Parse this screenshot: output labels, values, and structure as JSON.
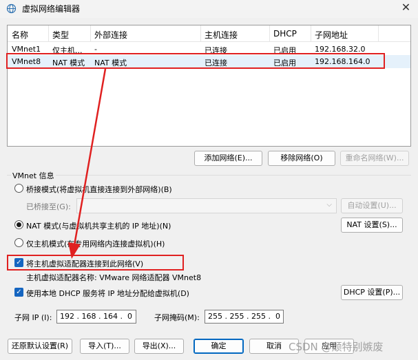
{
  "window": {
    "title": "虚拟网络编辑器",
    "close_glyph": "✕"
  },
  "table": {
    "headers": [
      "名称",
      "类型",
      "外部连接",
      "主机连接",
      "DHCP",
      "子网地址"
    ],
    "rows": [
      [
        "VMnet1",
        "仅主机...",
        "-",
        "已连接",
        "已启用",
        "192.168.32.0"
      ],
      [
        "VMnet8",
        "NAT 模式",
        "NAT 模式",
        "已连接",
        "已启用",
        "192.168.164.0"
      ]
    ],
    "selected_row": 1
  },
  "list_buttons": {
    "add": "添加网络(E)...",
    "remove": "移除网络(O)",
    "rename": "重命名网络(W)..."
  },
  "vmnet_info": {
    "group_title": "VMnet 信息",
    "bridge_label": "桥接模式(将虚拟机直接连接到外部网络)(B)",
    "bridged_to_label": "已桥接至(G):",
    "bridged_to_value": "",
    "auto_settings": "自动设置(U)...",
    "nat_label": "NAT 模式(与虚拟机共享主机的 IP 地址)(N)",
    "nat_settings": "NAT 设置(S)...",
    "hostonly_label": "仅主机模式(在专用网络内连接虚拟机)(H)",
    "selected_mode": "nat",
    "connect_adapter_label": "将主机虚拟适配器连接到此网络(V)",
    "connect_adapter_checked": true,
    "adapter_name_label": "主机虚拟适配器名称: VMware 网络适配器 VMnet8",
    "dhcp_label": "使用本地 DHCP 服务将 IP 地址分配给虚拟机(D)",
    "dhcp_checked": true,
    "dhcp_settings": "DHCP 设置(P)...",
    "subnet_ip_label": "子网 IP (I):",
    "subnet_ip_value": "192 . 168 . 164 .  0",
    "subnet_mask_label": "子网掩码(M):",
    "subnet_mask_value": "255 . 255 . 255 .  0"
  },
  "bottom_buttons": {
    "restore": "还原默认设置(R)",
    "import": "导入(T)...",
    "export": "导出(X)...",
    "ok": "确定",
    "cancel": "取消",
    "apply": "应用"
  },
  "watermark": "CSDN @颓特别嫉废",
  "colors": {
    "annotation_red": "#e02020",
    "selection": "#e5f1fb",
    "accent": "#1565c0"
  }
}
